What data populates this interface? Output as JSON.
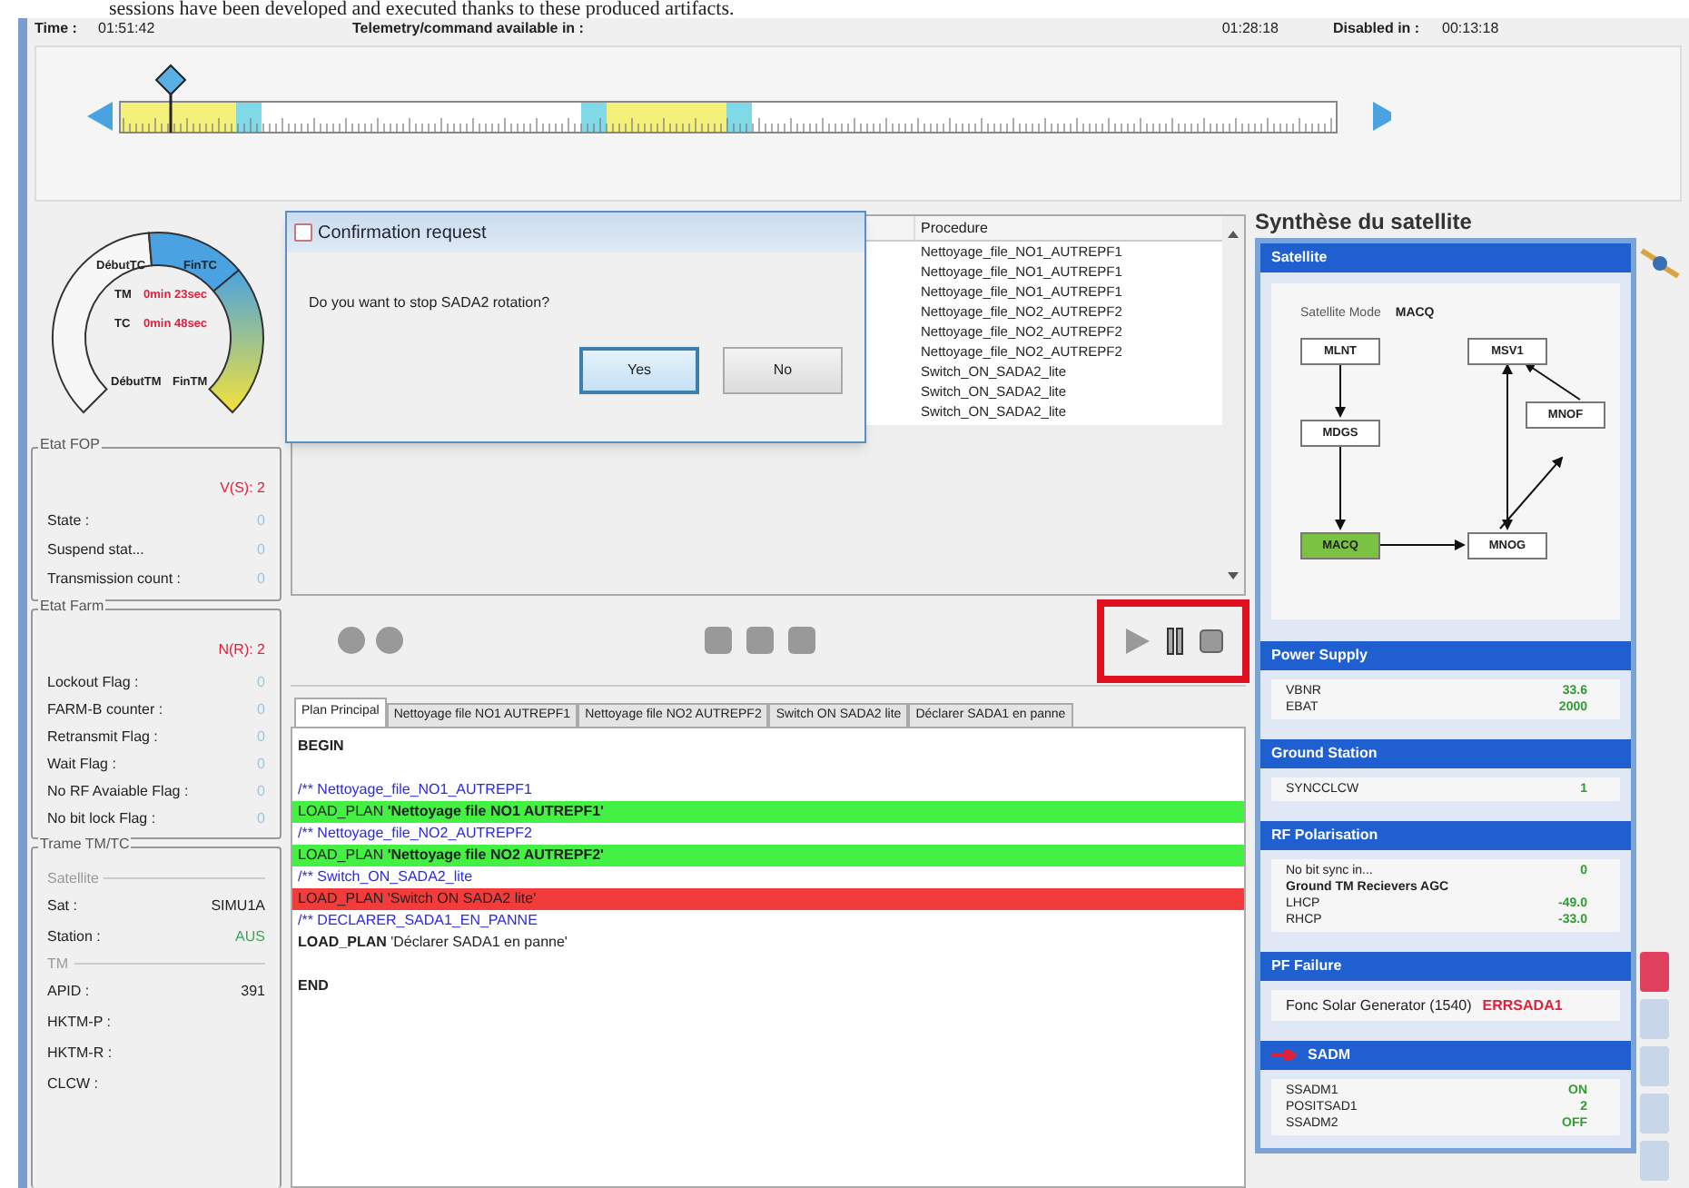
{
  "caption": "sessions have been developed and executed thanks to these produced artifacts.",
  "header": [
    {
      "label": "Time :",
      "value": "01:51:42"
    },
    {
      "label": "Telemetry/command available in :",
      "value": "01:28:18"
    },
    {
      "label": "Disabled in :",
      "value": "00:13:18"
    }
  ],
  "gauge": {
    "labels": [
      "DébutTC",
      "FinTC",
      "TM",
      "0min 23sec",
      "TC",
      "0min 48sec",
      "DébutTM",
      "FinTM"
    ]
  },
  "fop": {
    "title": "Etat FOP",
    "counter": "V(S): 2",
    "rows": [
      {
        "label": "State :",
        "value": "0"
      },
      {
        "label": "Suspend stat...",
        "value": "0"
      },
      {
        "label": "Transmission count :",
        "value": "0"
      }
    ]
  },
  "farm": {
    "title": "Etat Farm",
    "counter": "N(R): 2",
    "rows": [
      {
        "label": "Lockout Flag :",
        "value": "0"
      },
      {
        "label": "FARM-B counter :",
        "value": "0"
      },
      {
        "label": "Retransmit Flag :",
        "value": "0"
      },
      {
        "label": "Wait Flag :",
        "value": "0"
      },
      {
        "label": "No RF Avaiable Flag :",
        "value": "0"
      },
      {
        "label": "No bit lock Flag :",
        "value": "0"
      }
    ]
  },
  "frame": {
    "title": "Trame TM/TC",
    "groups": [
      {
        "title": "Satellite",
        "rows": [
          {
            "label": "Sat :",
            "value": "SIMU1A",
            "color": "#222222"
          },
          {
            "label": "Station :",
            "value": "AUS",
            "color": "#3aa655"
          }
        ]
      },
      {
        "title": "TM",
        "rows": [
          {
            "label": "APID :",
            "value": "391",
            "color": "#222222"
          },
          {
            "label": "HKTM-P :"
          },
          {
            "label": "HKTM-R :"
          },
          {
            "label": "CLCW :"
          }
        ]
      }
    ]
  },
  "procedures": {
    "column": "Procedure",
    "rows": [
      "Nettoyage_file_NO1_AUTREPF1",
      "Nettoyage_file_NO1_AUTREPF1",
      "Nettoyage_file_NO1_AUTREPF1",
      "Nettoyage_file_NO2_AUTREPF2",
      "Nettoyage_file_NO2_AUTREPF2",
      "Nettoyage_file_NO2_AUTREPF2",
      "Switch_ON_SADA2_lite",
      "Switch_ON_SADA2_lite",
      "Switch_ON_SADA2_lite"
    ]
  },
  "dialog": {
    "title": "Confirmation request",
    "message": "Do you want to stop SADA2 rotation?",
    "buttons": [
      {
        "label": "Yes",
        "selected": true
      },
      {
        "label": "No",
        "selected": false
      }
    ]
  },
  "tabs": [
    {
      "label": "Plan Principal",
      "selected": true
    },
    {
      "label": "Nettoyage file NO1 AUTREPF1",
      "selected": false
    },
    {
      "label": "Nettoyage file NO2 AUTREPF2",
      "selected": false
    },
    {
      "label": "Switch ON SADA2 lite",
      "selected": false
    },
    {
      "label": "Déclarer SADA1 en panne",
      "selected": false
    }
  ],
  "editor": [
    {
      "kind": "keyword",
      "text": "BEGIN"
    },
    {
      "kind": "blank"
    },
    {
      "kind": "comment",
      "text": "/** Nettoyage_file_NO1_AUTREPF1"
    },
    {
      "kind": "load",
      "succeeded": true,
      "failed": false,
      "text": "LOAD_PLAN **'Nettoyage file NO1 AUTREPF1'**"
    },
    {
      "kind": "comment",
      "text": "/** Nettoyage_file_NO2_AUTREPF2"
    },
    {
      "kind": "load",
      "succeeded": true,
      "failed": false,
      "text": "LOAD_PLAN **'Nettoyage file NO2 AUTREPF2'**"
    },
    {
      "kind": "comment",
      "text": "/** Switch_ON_SADA2_lite"
    },
    {
      "kind": "load",
      "succeeded": false,
      "failed": true,
      "text": "LOAD_PLAN 'Switch ON SADA2 lite'"
    },
    {
      "kind": "comment",
      "text": "/** DECLARER_SADA1_EN_PANNE"
    },
    {
      "kind": "load",
      "succeeded": false,
      "failed": false,
      "text": "**LOAD_PLAN** 'Déclarer SADA1 en panne'"
    },
    {
      "kind": "blank"
    },
    {
      "kind": "keyword",
      "text": "END"
    }
  ],
  "synthesis": {
    "title": "Synthèse du satellite",
    "satellite": {
      "title": "Satellite",
      "mode_label": "Satellite Mode",
      "mode": "MACQ",
      "nodes": [
        {
          "label": "MLNT",
          "active": false
        },
        {
          "label": "MSV1",
          "active": false
        },
        {
          "label": "MDGS",
          "active": false
        },
        {
          "label": "MNOF",
          "active": false
        },
        {
          "label": "MACQ",
          "active": true
        },
        {
          "label": "MNOG",
          "active": false
        }
      ]
    },
    "sections": [
      {
        "title": "Power Supply",
        "alert": false,
        "rows": [
          {
            "label": "VBNR",
            "value": "33.6",
            "color": "#2e9e2e"
          },
          {
            "label": "EBAT",
            "value": "2000",
            "color": "#2e9e2e"
          }
        ]
      },
      {
        "title": "Ground Station",
        "alert": false,
        "rows": [
          {
            "label": "SYNCCLCW",
            "value": "1",
            "color": "#2e9e2e"
          }
        ]
      },
      {
        "title": "RF Polarisation",
        "alert": false,
        "rows": [
          {
            "label": "No bit sync in...",
            "value": "0",
            "color": "#2e9e2e"
          },
          {
            "label": "Ground TM Recievers AGC",
            "kind": "heading"
          },
          {
            "label": "LHCP",
            "value": "-49.0",
            "color": "#2e9e2e"
          },
          {
            "label": "RHCP",
            "value": "-33.0",
            "color": "#2e9e2e"
          }
        ]
      },
      {
        "title": "PF Failure",
        "alert": false,
        "rows": [
          {
            "label": "Fonc Solar Generator (1540)",
            "value": "ERRSADA1",
            "color": "#e0203a",
            "kind": "inline"
          }
        ]
      },
      {
        "title": "SADM",
        "alert": true,
        "rows": [
          {
            "label": "SSADM1",
            "value": "ON",
            "color": "#2e9e2e"
          },
          {
            "label": "POSITSAD1",
            "value": "2",
            "color": "#2e9e2e"
          },
          {
            "label": "SSADM2",
            "value": "OFF",
            "color": "#2e9e2e"
          }
        ]
      }
    ]
  },
  "side_indicators": [
    {
      "alert": true
    },
    {
      "alert": false
    },
    {
      "alert": false
    },
    {
      "alert": false
    },
    {
      "alert": false
    }
  ]
}
